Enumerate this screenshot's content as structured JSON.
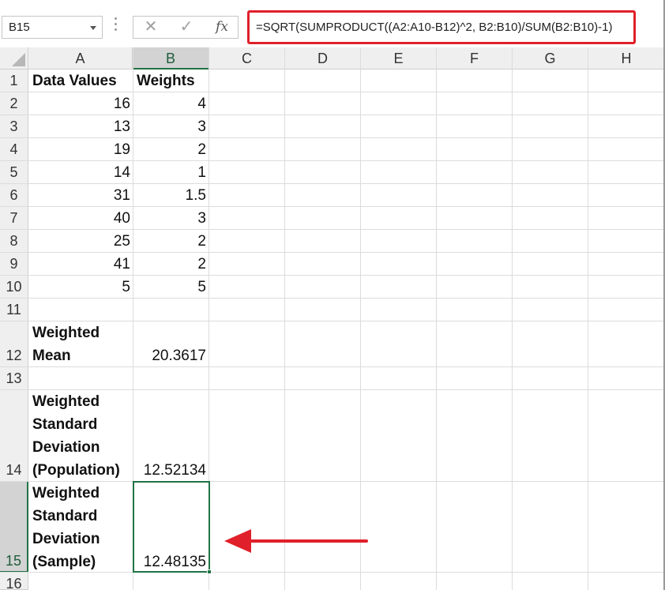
{
  "name_box": {
    "value": "B15"
  },
  "formula_bar": {
    "cancel_glyph": "✕",
    "enter_glyph": "✓",
    "fx_label": "fx",
    "formula": "=SQRT(SUMPRODUCT((A2:A10-B12)^2, B2:B10)/SUM(B2:B10)-1)"
  },
  "columns": [
    "A",
    "B",
    "C",
    "D",
    "E",
    "F",
    "G",
    "H"
  ],
  "rows": [
    "1",
    "2",
    "3",
    "4",
    "5",
    "6",
    "7",
    "8",
    "9",
    "10",
    "11",
    "12",
    "13",
    "14",
    "15",
    "16"
  ],
  "header_row": {
    "a": "Data Values",
    "b": "Weights"
  },
  "data": [
    {
      "a": "16",
      "b": "4"
    },
    {
      "a": "13",
      "b": "3"
    },
    {
      "a": "19",
      "b": "2"
    },
    {
      "a": "14",
      "b": "1"
    },
    {
      "a": "31",
      "b": "1.5"
    },
    {
      "a": "40",
      "b": "3"
    },
    {
      "a": "25",
      "b": "2"
    },
    {
      "a": "41",
      "b": "2"
    },
    {
      "a": "5",
      "b": "5"
    }
  ],
  "weighted_mean": {
    "label_1": "Weighted",
    "label_2": "Mean",
    "value": "20.3617"
  },
  "std_population": {
    "label_1": "Weighted",
    "label_2": "Standard",
    "label_3": "Deviation",
    "label_4": "(Population)",
    "value": "12.52134"
  },
  "std_sample": {
    "label_1": "Weighted",
    "label_2": "Standard",
    "label_3": "Deviation",
    "label_4": "(Sample)",
    "value": "12.48135"
  },
  "colors": {
    "accent_green": "#217346",
    "highlight_red": "#e0202a"
  }
}
